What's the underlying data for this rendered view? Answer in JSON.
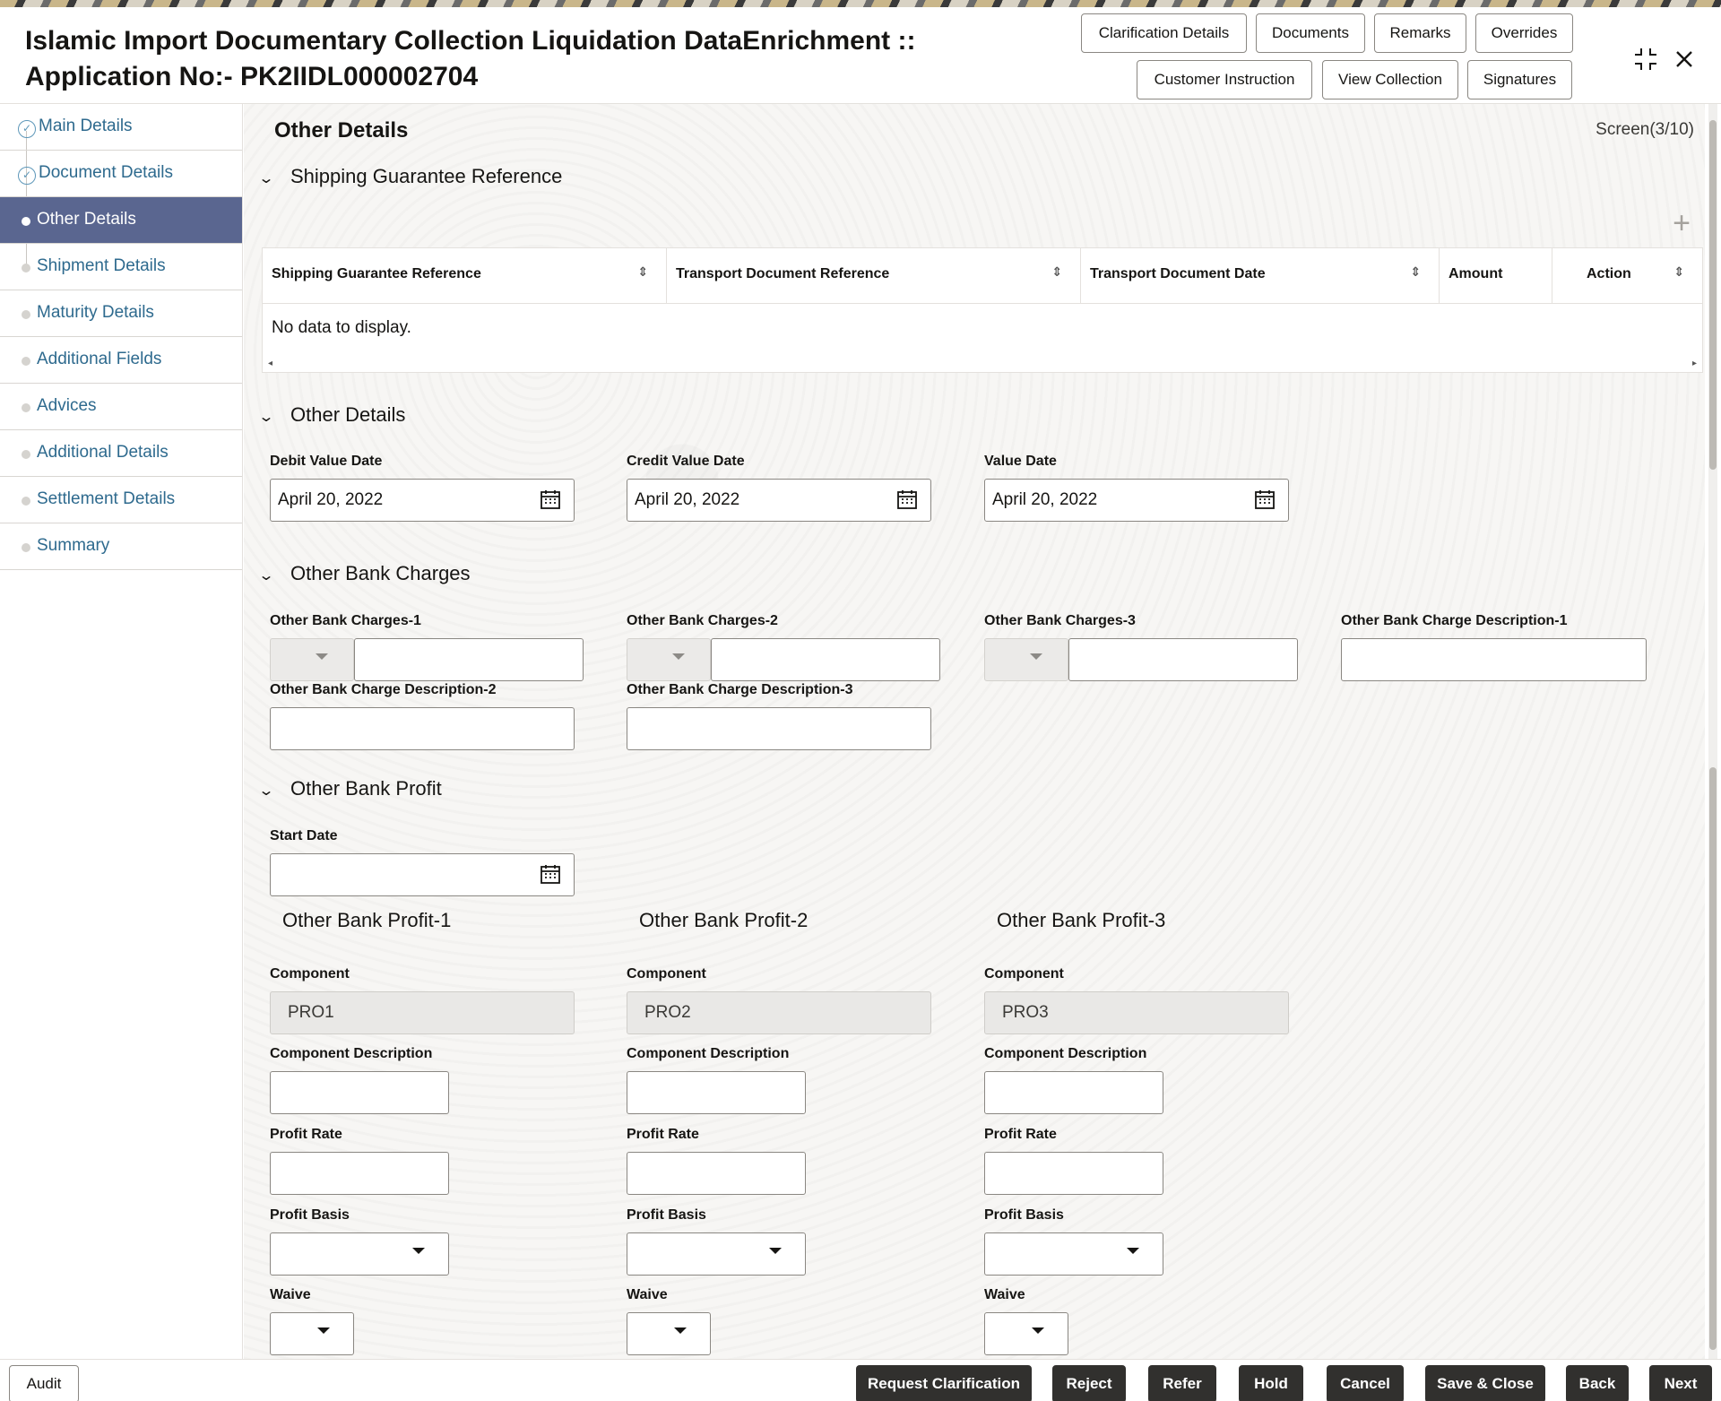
{
  "header": {
    "title_line1": "Islamic Import Documentary Collection Liquidation DataEnrichment ::",
    "title_line2": "Application No:- PK2IIDL000002704",
    "buttons_row1": [
      "Clarification Details",
      "Documents",
      "Remarks",
      "Overrides"
    ],
    "buttons_row2": [
      "Customer Instruction",
      "View Collection",
      "Signatures"
    ],
    "icons": [
      "collapse-icon",
      "close-icon"
    ]
  },
  "sidebar": {
    "items": [
      {
        "label": "Main Details",
        "state": "done"
      },
      {
        "label": "Document Details",
        "state": "done"
      },
      {
        "label": "Other Details",
        "state": "active"
      },
      {
        "label": "Shipment Details",
        "state": "pending"
      },
      {
        "label": "Maturity Details",
        "state": "pending"
      },
      {
        "label": "Additional Fields",
        "state": "pending"
      },
      {
        "label": "Advices",
        "state": "pending"
      },
      {
        "label": "Additional Details",
        "state": "pending"
      },
      {
        "label": "Settlement Details",
        "state": "pending"
      },
      {
        "label": "Summary",
        "state": "pending"
      }
    ]
  },
  "main": {
    "page_title": "Other Details",
    "screen_indicator": "Screen(3/10)",
    "shipping_section": {
      "title": "Shipping Guarantee Reference",
      "columns": [
        "Shipping Guarantee Reference",
        "Transport Document Reference",
        "Transport Document Date",
        "Amount",
        "Action"
      ],
      "empty_text": "No data to display."
    },
    "other_details_section": {
      "title": "Other Details",
      "fields": [
        {
          "label": "Debit Value Date",
          "value": "April 20, 2022"
        },
        {
          "label": "Credit Value Date",
          "value": "April 20, 2022"
        },
        {
          "label": "Value Date",
          "value": "April 20, 2022"
        }
      ]
    },
    "charges_section": {
      "title": "Other Bank Charges",
      "charges": [
        {
          "label": "Other Bank Charges-1",
          "value": ""
        },
        {
          "label": "Other Bank Charges-2",
          "value": ""
        },
        {
          "label": "Other Bank Charges-3",
          "value": ""
        }
      ],
      "descriptions": [
        {
          "label": "Other Bank Charge Description-1",
          "value": ""
        },
        {
          "label": "Other Bank Charge Description-2",
          "value": ""
        },
        {
          "label": "Other Bank Charge Description-3",
          "value": ""
        }
      ]
    },
    "profit_section": {
      "title": "Other Bank Profit",
      "start_date_label": "Start Date",
      "start_date_value": "",
      "profits": [
        {
          "title": "Other Bank Profit-1",
          "component_label": "Component",
          "component": "PRO1",
          "description_label": "Component Description",
          "rate_label": "Profit Rate",
          "basis_label": "Profit Basis",
          "waive_label": "Waive"
        },
        {
          "title": "Other Bank Profit-2",
          "component_label": "Component",
          "component": "PRO2",
          "description_label": "Component Description",
          "rate_label": "Profit Rate",
          "basis_label": "Profit Basis",
          "waive_label": "Waive"
        },
        {
          "title": "Other Bank Profit-3",
          "component_label": "Component",
          "component": "PRO3",
          "description_label": "Component Description",
          "rate_label": "Profit Rate",
          "basis_label": "Profit Basis",
          "waive_label": "Waive"
        }
      ]
    }
  },
  "footer": {
    "audit": "Audit",
    "buttons": [
      "Request Clarification",
      "Reject",
      "Refer",
      "Hold",
      "Cancel",
      "Save & Close",
      "Back",
      "Next"
    ]
  },
  "colors": {
    "active_nav": "#5a6690",
    "link": "#2e6a8e",
    "footer_button": "#31302e"
  }
}
